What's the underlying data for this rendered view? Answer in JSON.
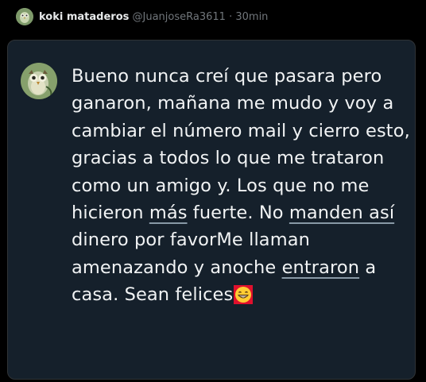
{
  "header": {
    "display_name": "koki mataderos",
    "handle": "@JuanjoseRa3611",
    "separator": "·",
    "timestamp": "30min",
    "avatar_icon": "owl-avatar-icon"
  },
  "tweet": {
    "avatar_icon": "owl-avatar-icon",
    "lines": [
      {
        "a": "Bueno nunca creí que pasara pero"
      },
      {
        "a": "ganaron, mañana me mudo y voy a"
      },
      {
        "a": "cambiar el número mail y cierro esto,"
      },
      {
        "a": "gracias a todos lo que me trataron"
      },
      {
        "a": "como un amigo y. Los que no me"
      },
      {
        "a": "hicieron ",
        "u1": "más",
        "b": " fuerte. No ",
        "u2": "manden así"
      },
      {
        "a": "dinero por favorMe llaman"
      },
      {
        "a": "amenazando y anoche ",
        "u1": "entraron",
        "b": " a"
      },
      {
        "a": "casa. Sean felices",
        "emoji": "grinning-face-emoji"
      }
    ]
  },
  "colors": {
    "page_background": "#000000",
    "card_background": "#15202b",
    "text_primary": "#f1f3f4",
    "text_secondary": "#71767b",
    "emoji_background": "#e0102d",
    "emoji_face": "#ffcc33"
  }
}
